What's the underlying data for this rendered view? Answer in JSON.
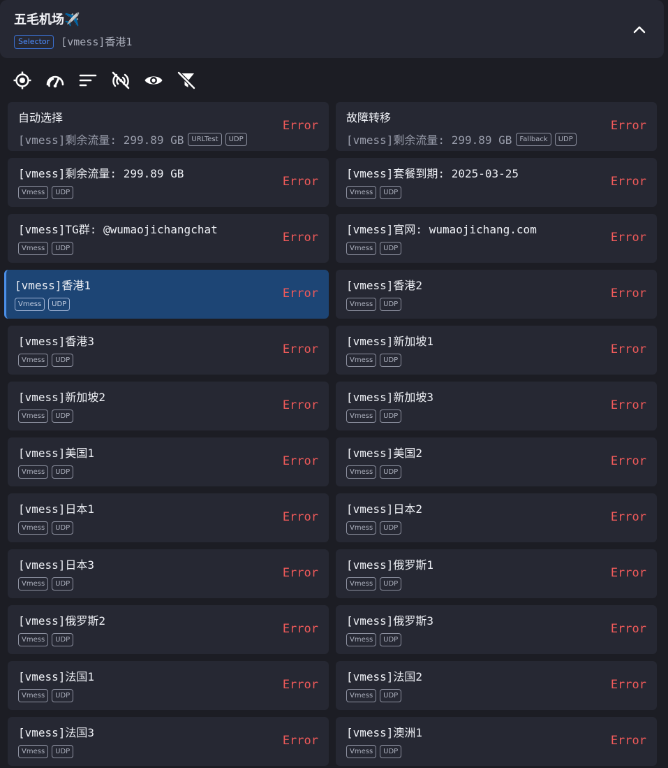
{
  "group": {
    "title": "五毛机场✈️",
    "type": "Selector",
    "selected": "[vmess]香港1"
  },
  "toolbar": [
    "locate-icon",
    "speed-test-icon",
    "sort-icon",
    "filter-signal-icon",
    "eye-icon",
    "filter-off-icon"
  ],
  "colors": {
    "error": "#ef5a5a",
    "selected_bg": "#1d4575",
    "card_bg": "#262833",
    "accent": "#4b8fe8"
  },
  "proxies": [
    {
      "name": "自动选择",
      "note": "[vmess]剩余流量: 299.89 GB",
      "tags": [
        "URLTest",
        "UDP"
      ],
      "delay": "Error",
      "selected": false
    },
    {
      "name": "故障转移",
      "note": "[vmess]剩余流量: 299.89 GB",
      "tags": [
        "Fallback",
        "UDP"
      ],
      "delay": "Error",
      "selected": false
    },
    {
      "name": "[vmess]剩余流量: 299.89 GB",
      "tags": [
        "Vmess",
        "UDP"
      ],
      "delay": "Error",
      "selected": false
    },
    {
      "name": "[vmess]套餐到期: 2025-03-25",
      "tags": [
        "Vmess",
        "UDP"
      ],
      "delay": "Error",
      "selected": false
    },
    {
      "name": "[vmess]TG群: @wumaojichangchat",
      "tags": [
        "Vmess",
        "UDP"
      ],
      "delay": "Error",
      "selected": false
    },
    {
      "name": "[vmess]官网: wumaojichang.com",
      "tags": [
        "Vmess",
        "UDP"
      ],
      "delay": "Error",
      "selected": false
    },
    {
      "name": "[vmess]香港1",
      "tags": [
        "Vmess",
        "UDP"
      ],
      "delay": "Error",
      "selected": true
    },
    {
      "name": "[vmess]香港2",
      "tags": [
        "Vmess",
        "UDP"
      ],
      "delay": "Error",
      "selected": false
    },
    {
      "name": "[vmess]香港3",
      "tags": [
        "Vmess",
        "UDP"
      ],
      "delay": "Error",
      "selected": false
    },
    {
      "name": "[vmess]新加坡1",
      "tags": [
        "Vmess",
        "UDP"
      ],
      "delay": "Error",
      "selected": false
    },
    {
      "name": "[vmess]新加坡2",
      "tags": [
        "Vmess",
        "UDP"
      ],
      "delay": "Error",
      "selected": false
    },
    {
      "name": "[vmess]新加坡3",
      "tags": [
        "Vmess",
        "UDP"
      ],
      "delay": "Error",
      "selected": false
    },
    {
      "name": "[vmess]美国1",
      "tags": [
        "Vmess",
        "UDP"
      ],
      "delay": "Error",
      "selected": false
    },
    {
      "name": "[vmess]美国2",
      "tags": [
        "Vmess",
        "UDP"
      ],
      "delay": "Error",
      "selected": false
    },
    {
      "name": "[vmess]日本1",
      "tags": [
        "Vmess",
        "UDP"
      ],
      "delay": "Error",
      "selected": false
    },
    {
      "name": "[vmess]日本2",
      "tags": [
        "Vmess",
        "UDP"
      ],
      "delay": "Error",
      "selected": false
    },
    {
      "name": "[vmess]日本3",
      "tags": [
        "Vmess",
        "UDP"
      ],
      "delay": "Error",
      "selected": false
    },
    {
      "name": "[vmess]俄罗斯1",
      "tags": [
        "Vmess",
        "UDP"
      ],
      "delay": "Error",
      "selected": false
    },
    {
      "name": "[vmess]俄罗斯2",
      "tags": [
        "Vmess",
        "UDP"
      ],
      "delay": "Error",
      "selected": false
    },
    {
      "name": "[vmess]俄罗斯3",
      "tags": [
        "Vmess",
        "UDP"
      ],
      "delay": "Error",
      "selected": false
    },
    {
      "name": "[vmess]法国1",
      "tags": [
        "Vmess",
        "UDP"
      ],
      "delay": "Error",
      "selected": false
    },
    {
      "name": "[vmess]法国2",
      "tags": [
        "Vmess",
        "UDP"
      ],
      "delay": "Error",
      "selected": false
    },
    {
      "name": "[vmess]法国3",
      "tags": [
        "Vmess",
        "UDP"
      ],
      "delay": "Error",
      "selected": false
    },
    {
      "name": "[vmess]澳洲1",
      "tags": [
        "Vmess",
        "UDP"
      ],
      "delay": "Error",
      "selected": false
    }
  ]
}
